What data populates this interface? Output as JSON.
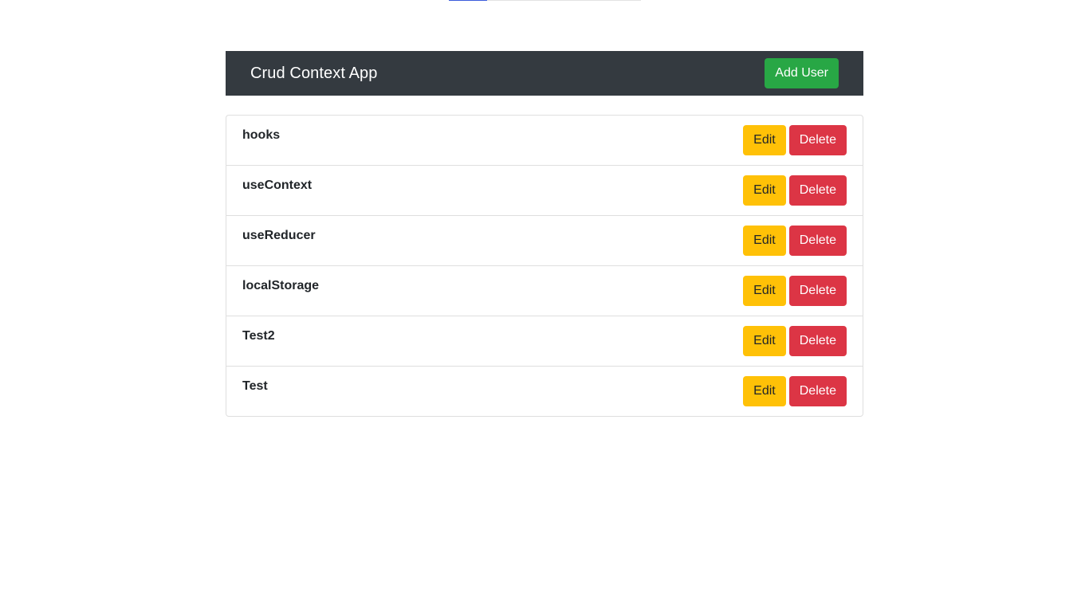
{
  "app": {
    "title": "Crud Context App",
    "add_user_label": "Add User"
  },
  "loading_progress": 0.2,
  "users": [
    {
      "name": "hooks",
      "edit_label": "Edit",
      "delete_label": "Delete"
    },
    {
      "name": "useContext",
      "edit_label": "Edit",
      "delete_label": "Delete"
    },
    {
      "name": "useReducer",
      "edit_label": "Edit",
      "delete_label": "Delete"
    },
    {
      "name": "localStorage",
      "edit_label": "Edit",
      "delete_label": "Delete"
    },
    {
      "name": "Test2",
      "edit_label": "Edit",
      "delete_label": "Delete"
    },
    {
      "name": "Test",
      "edit_label": "Edit",
      "delete_label": "Delete"
    }
  ],
  "colors": {
    "navbar": "#343a40",
    "success": "#28a745",
    "warning": "#ffc107",
    "danger": "#dc3545",
    "progress": "#3b5bdb"
  }
}
